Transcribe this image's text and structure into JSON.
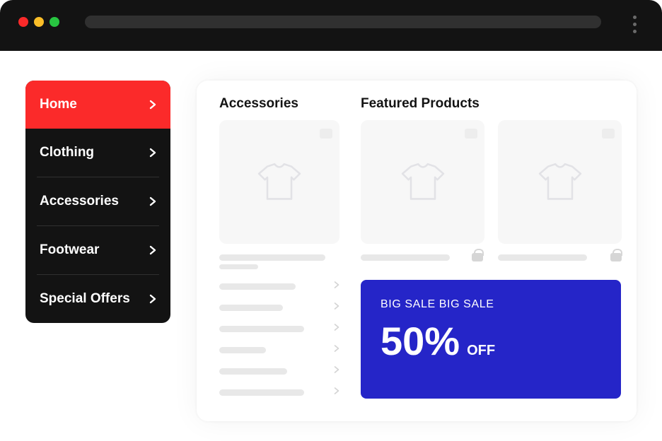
{
  "sidebar": {
    "items": [
      {
        "label": "Home",
        "active": true
      },
      {
        "label": "Clothing"
      },
      {
        "label": "Accessories"
      },
      {
        "label": "Footwear"
      },
      {
        "label": "Special Offers"
      }
    ]
  },
  "main": {
    "section_accessories": "Accessories",
    "section_featured": "Featured Products"
  },
  "promo": {
    "subtitle": "BIG SALE BIG SALE",
    "percent": "50%",
    "off": "OFF"
  },
  "colors": {
    "accent_red": "#fb2a2a",
    "promo_blue": "#2525c8",
    "sidebar_bg": "#131313"
  }
}
